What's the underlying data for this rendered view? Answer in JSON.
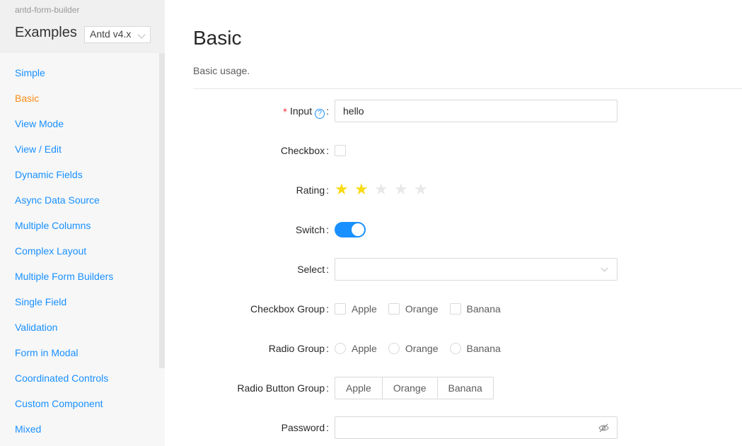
{
  "sidebar": {
    "app_name": "antd-form-builder",
    "title": "Examples",
    "version": "Antd v4.x",
    "items": [
      {
        "label": "Simple",
        "active": false
      },
      {
        "label": "Basic",
        "active": true
      },
      {
        "label": "View Mode",
        "active": false
      },
      {
        "label": "View / Edit",
        "active": false
      },
      {
        "label": "Dynamic Fields",
        "active": false
      },
      {
        "label": "Async Data Source",
        "active": false
      },
      {
        "label": "Multiple Columns",
        "active": false
      },
      {
        "label": "Complex Layout",
        "active": false
      },
      {
        "label": "Multiple Form Builders",
        "active": false
      },
      {
        "label": "Single Field",
        "active": false
      },
      {
        "label": "Validation",
        "active": false
      },
      {
        "label": "Form in Modal",
        "active": false
      },
      {
        "label": "Coordinated Controls",
        "active": false
      },
      {
        "label": "Custom Component",
        "active": false
      },
      {
        "label": "Mixed",
        "active": false
      }
    ]
  },
  "main": {
    "title": "Basic",
    "description": "Basic usage.",
    "fields": {
      "input": {
        "label": "Input",
        "value": "hello",
        "required": true
      },
      "checkbox": {
        "label": "Checkbox",
        "checked": false
      },
      "rating": {
        "label": "Rating",
        "value": 2,
        "max": 5
      },
      "switch": {
        "label": "Switch",
        "on": true
      },
      "select": {
        "label": "Select",
        "value": ""
      },
      "checkbox_group": {
        "label": "Checkbox Group",
        "options": [
          "Apple",
          "Orange",
          "Banana"
        ]
      },
      "radio_group": {
        "label": "Radio Group",
        "options": [
          "Apple",
          "Orange",
          "Banana"
        ]
      },
      "radio_button_group": {
        "label": "Radio Button Group",
        "options": [
          "Apple",
          "Orange",
          "Banana"
        ]
      },
      "password": {
        "label": "Password",
        "value": ""
      }
    }
  },
  "colors": {
    "link": "#1890ff",
    "active": "#fa8c16",
    "star": "#fadb14",
    "required": "#f5222d"
  },
  "icons": {
    "help": "question-circle-icon",
    "star": "star-icon",
    "eye": "eye-invisible-icon",
    "chevron": "chevron-down-icon"
  }
}
